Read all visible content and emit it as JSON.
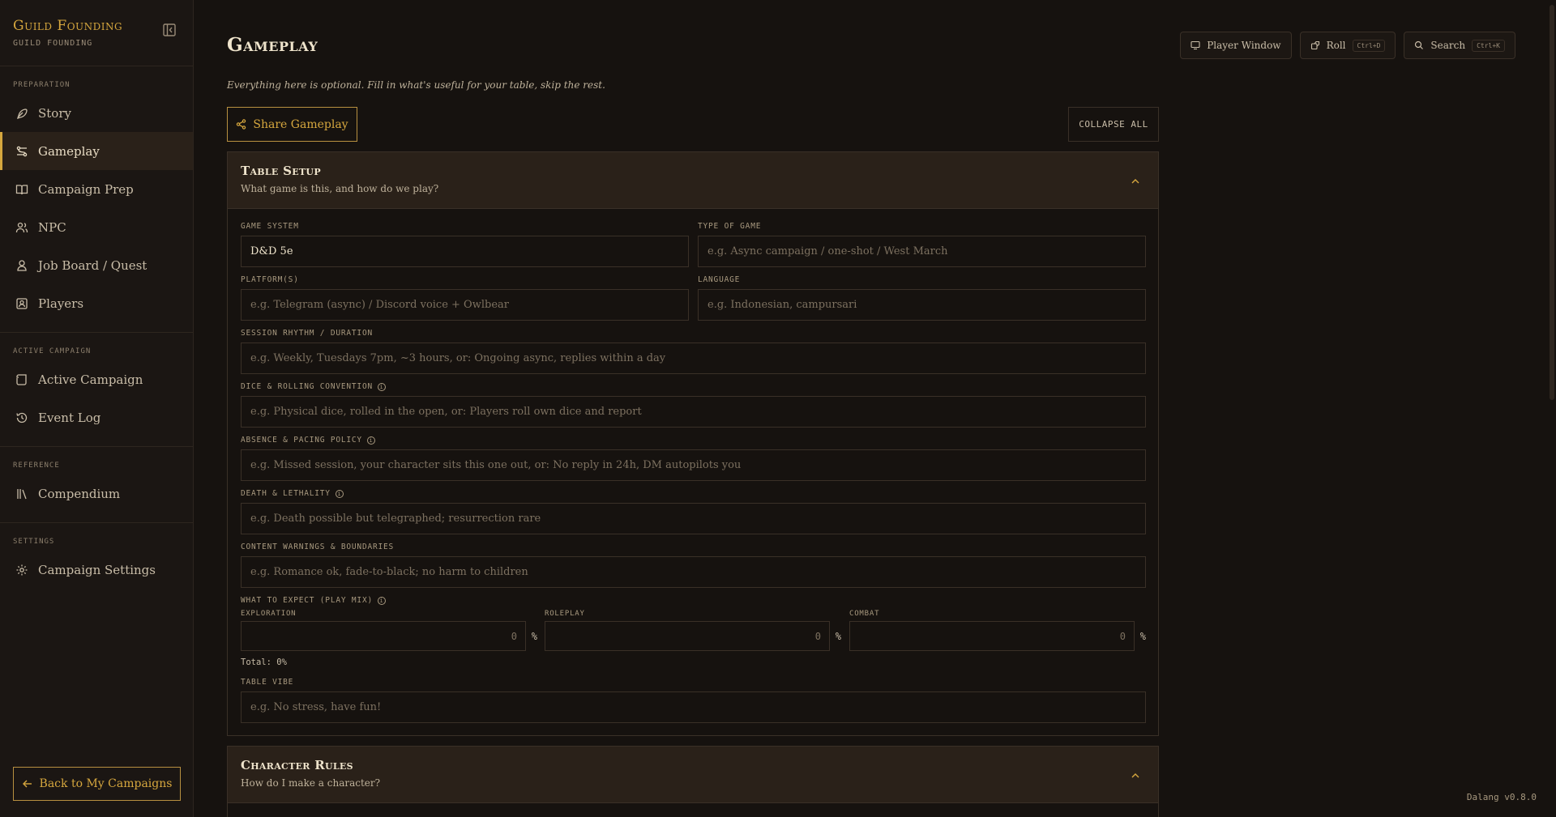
{
  "app": {
    "title": "Guild Founding",
    "subtitle": "GUILD FOUNDING",
    "version": "Dalang v0.8.0"
  },
  "sidebar": {
    "sections": [
      {
        "label": "PREPARATION",
        "items": [
          {
            "label": "Story",
            "icon": "feather-icon"
          },
          {
            "label": "Gameplay",
            "icon": "sliders-icon",
            "active": true
          },
          {
            "label": "Campaign Prep",
            "icon": "book-icon"
          },
          {
            "label": "NPC",
            "icon": "users-icon"
          },
          {
            "label": "Job Board / Quest",
            "icon": "quest-icon"
          },
          {
            "label": "Players",
            "icon": "id-card-icon"
          }
        ]
      },
      {
        "label": "ACTIVE CAMPAIGN",
        "items": [
          {
            "label": "Active Campaign",
            "icon": "scroll-icon"
          },
          {
            "label": "Event Log",
            "icon": "history-icon"
          }
        ]
      },
      {
        "label": "REFERENCE",
        "items": [
          {
            "label": "Compendium",
            "icon": "library-icon"
          }
        ]
      },
      {
        "label": "SETTINGS",
        "items": [
          {
            "label": "Campaign Settings",
            "icon": "gear-icon"
          }
        ]
      }
    ],
    "back_label": "Back to My Campaigns"
  },
  "topbar": {
    "player_window": "Player Window",
    "roll": "Roll",
    "roll_kbd": "Ctrl+D",
    "search": "Search",
    "search_kbd": "Ctrl+K"
  },
  "page": {
    "title": "Gameplay",
    "subtitle": "Everything here is optional. Fill in what's useful for your table, skip the rest.",
    "share_label": "Share Gameplay",
    "collapse_all_label": "COLLAPSE ALL"
  },
  "table_setup": {
    "title": "Table Setup",
    "description": "What game is this, and how do we play?",
    "game_system": {
      "label": "GAME SYSTEM",
      "value": "D&D 5e"
    },
    "type_of_game": {
      "label": "TYPE OF GAME",
      "placeholder": "e.g. Async campaign / one-shot / West March"
    },
    "platforms": {
      "label": "PLATFORM(S)",
      "placeholder": "e.g. Telegram (async) / Discord voice + Owlbear"
    },
    "language": {
      "label": "LANGUAGE",
      "placeholder": "e.g. Indonesian, campursari"
    },
    "session_rhythm": {
      "label": "SESSION RHYTHM / DURATION",
      "placeholder": "e.g. Weekly, Tuesdays 7pm, ~3 hours, or: Ongoing async, replies within a day"
    },
    "dice": {
      "label": "DICE & ROLLING CONVENTION",
      "placeholder": "e.g. Physical dice, rolled in the open, or: Players roll own dice and report"
    },
    "absence": {
      "label": "ABSENCE & PACING POLICY",
      "placeholder": "e.g. Missed session, your character sits this one out, or: No reply in 24h, DM autopilots you"
    },
    "death": {
      "label": "DEATH & LETHALITY",
      "placeholder": "e.g. Death possible but telegraphed; resurrection rare"
    },
    "content": {
      "label": "CONTENT WARNINGS & BOUNDARIES",
      "placeholder": "e.g. Romance ok, fade-to-black; no harm to children"
    },
    "play_mix": {
      "label": "WHAT TO EXPECT (PLAY MIX)",
      "exploration": {
        "label": "EXPLORATION",
        "value": "0"
      },
      "roleplay": {
        "label": "ROLEPLAY",
        "value": "0"
      },
      "combat": {
        "label": "COMBAT",
        "value": "0"
      },
      "percent": "%",
      "total": "Total: 0%"
    },
    "vibe": {
      "label": "TABLE VIBE",
      "placeholder": "e.g. No stress, have fun!"
    }
  },
  "character_rules": {
    "title": "Character Rules",
    "description": "How do I make a character?"
  },
  "colors": {
    "accent": "#d6a73e",
    "background": "#16120f",
    "panel_head": "#2a2119"
  }
}
